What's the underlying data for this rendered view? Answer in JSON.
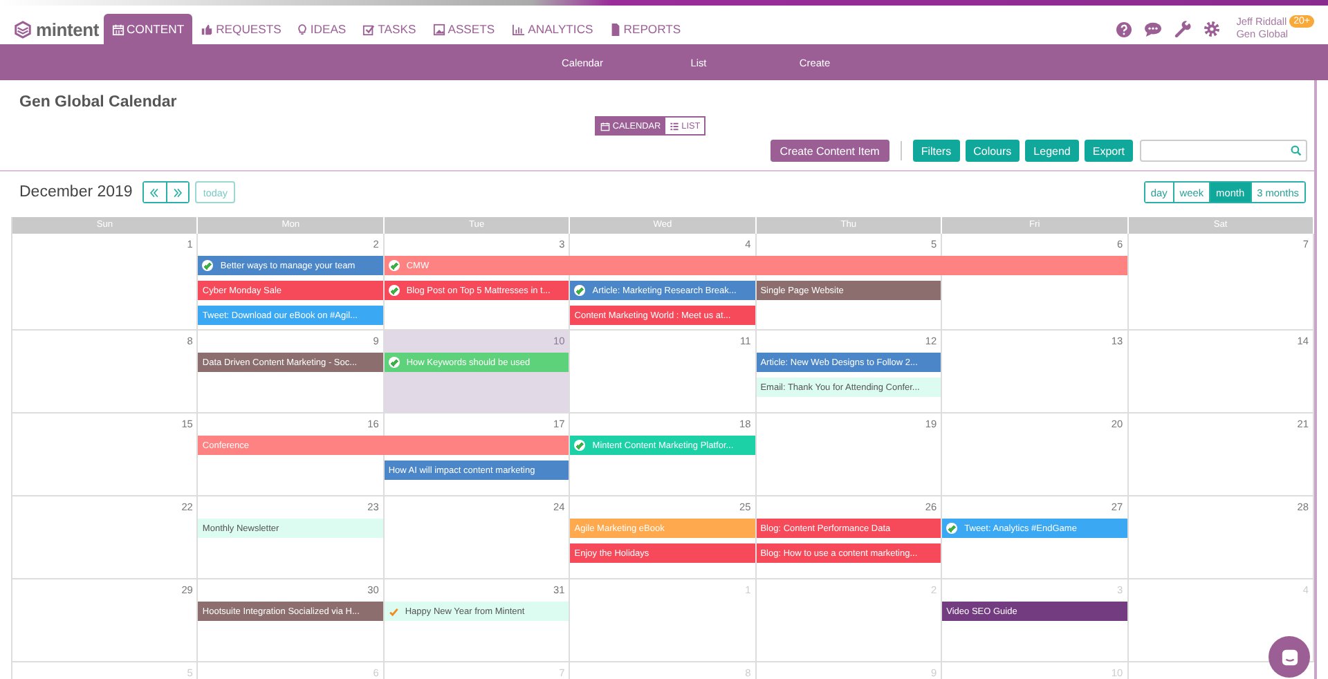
{
  "top_nav": {
    "logo": "mintent",
    "tabs": [
      {
        "label": "CONTENT",
        "selected": true
      },
      {
        "label": "REQUESTS",
        "selected": false
      },
      {
        "label": "IDEAS",
        "selected": false
      },
      {
        "label": "TASKS",
        "selected": false
      },
      {
        "label": "ASSETS",
        "selected": false
      },
      {
        "label": "ANALYTICS",
        "selected": false
      },
      {
        "label": "REPORTS",
        "selected": false
      }
    ],
    "user": {
      "name": "Jeff Riddall",
      "badge": "20+",
      "org": "Gen Global"
    }
  },
  "sub_nav": {
    "links": [
      "Calendar",
      "List",
      "Create"
    ]
  },
  "page": {
    "title": "Gen Global Calendar",
    "view_toggle": [
      {
        "label": "CALENDAR",
        "selected": true
      },
      {
        "label": "LIST",
        "selected": false
      }
    ],
    "actions": [
      {
        "label": "Create Content Item",
        "kind": "primary"
      },
      {
        "label": "Filters",
        "kind": "secondary"
      },
      {
        "label": "Colours",
        "kind": "secondary"
      },
      {
        "label": "Legend",
        "kind": "secondary"
      },
      {
        "label": "Export",
        "kind": "secondary"
      }
    ]
  },
  "calendar": {
    "month": "December 2019",
    "today_button": "today",
    "ranges": [
      {
        "label": "day",
        "selected": false
      },
      {
        "label": "week",
        "selected": false
      },
      {
        "label": "month",
        "selected": true
      },
      {
        "label": "3 months",
        "selected": false
      }
    ],
    "weekdays": [
      "Sun",
      "Mon",
      "Tue",
      "Wed",
      "Thu",
      "Fri",
      "Sat"
    ],
    "weeks": [
      {
        "days": [
          {
            "number": "1",
            "outside": false,
            "today": false
          },
          {
            "number": "2",
            "outside": false,
            "today": false
          },
          {
            "number": "3",
            "outside": false,
            "today": false
          },
          {
            "number": "4",
            "outside": false,
            "today": false
          },
          {
            "number": "5",
            "outside": false,
            "today": false
          },
          {
            "number": "6",
            "outside": false,
            "today": false
          },
          {
            "number": "7",
            "outside": false,
            "today": false
          }
        ],
        "lanes": [
          [
            {
              "kind": "empty"
            },
            {
              "kind": "event",
              "title": "Better ways to manage your team",
              "color": "#4a86c8",
              "checked": true,
              "check": {
                "color": "#3cb043"
              }
            },
            {
              "kind": "event",
              "title": "CMW",
              "color": "#ff8282",
              "checked": true,
              "check": {
                "color": "#3cb043"
              }
            },
            {
              "kind": "more"
            },
            {
              "kind": "more"
            },
            {
              "kind": "more"
            },
            {
              "kind": "empty"
            }
          ],
          [
            {
              "kind": "empty"
            },
            {
              "kind": "event",
              "title": "Cyber Monday Sale",
              "color": "#f64a5a",
              "checked": false
            },
            {
              "kind": "event",
              "title": "Blog Post on Top 5 Mattresses in t...",
              "color": "#f64a5a",
              "checked": true,
              "check": {
                "color": "#3cb043"
              }
            },
            {
              "kind": "event",
              "title": "Article: Marketing Research Break...",
              "color": "#4a86c8",
              "checked": true,
              "check": {
                "color": "#3cb043"
              }
            },
            {
              "kind": "event",
              "title": "Single Page Website",
              "color": "#8d6e6e",
              "checked": false
            },
            {
              "kind": "empty"
            },
            {
              "kind": "empty"
            }
          ],
          [
            {
              "kind": "empty"
            },
            {
              "kind": "event",
              "title": "Tweet: Download our eBook on #Agil...",
              "color": "#3aa8f2",
              "checked": false
            },
            {
              "kind": "empty"
            },
            {
              "kind": "event",
              "title": "Content Marketing World : Meet us at...",
              "color": "#f64a5a",
              "checked": false
            },
            {
              "kind": "empty"
            },
            {
              "kind": "empty"
            },
            {
              "kind": "empty"
            }
          ]
        ]
      },
      {
        "days": [
          {
            "number": "8",
            "outside": false,
            "today": false
          },
          {
            "number": "9",
            "outside": false,
            "today": false
          },
          {
            "number": "10",
            "outside": false,
            "today": true
          },
          {
            "number": "11",
            "outside": false,
            "today": false
          },
          {
            "number": "12",
            "outside": false,
            "today": false
          },
          {
            "number": "13",
            "outside": false,
            "today": false
          },
          {
            "number": "14",
            "outside": false,
            "today": false
          }
        ],
        "lanes": [
          [
            {
              "kind": "empty"
            },
            {
              "kind": "event",
              "title": "Data Driven Content Marketing - Soc...",
              "color": "#8d6e6e",
              "checked": false
            },
            {
              "kind": "event",
              "title": "How Keywords should be used",
              "color": "#5ed27a",
              "checked": true,
              "check": {
                "color": "#3cb043"
              }
            },
            {
              "kind": "empty"
            },
            {
              "kind": "event",
              "title": "Article: New Web Designs to Follow 2...",
              "color": "#4a86c8",
              "checked": false
            },
            {
              "kind": "empty"
            },
            {
              "kind": "empty"
            }
          ],
          [
            {
              "kind": "empty"
            },
            {
              "kind": "empty"
            },
            {
              "kind": "empty"
            },
            {
              "kind": "empty"
            },
            {
              "kind": "event",
              "title": "Email: Thank You for Attending Confer...",
              "color": "#dcfbf1",
              "checked": false
            },
            {
              "kind": "empty"
            },
            {
              "kind": "empty"
            }
          ]
        ]
      },
      {
        "days": [
          {
            "number": "15",
            "outside": false,
            "today": false
          },
          {
            "number": "16",
            "outside": false,
            "today": false
          },
          {
            "number": "17",
            "outside": false,
            "today": false
          },
          {
            "number": "18",
            "outside": false,
            "today": false
          },
          {
            "number": "19",
            "outside": false,
            "today": false
          },
          {
            "number": "20",
            "outside": false,
            "today": false
          },
          {
            "number": "21",
            "outside": false,
            "today": false
          }
        ],
        "lanes": [
          [
            {
              "kind": "empty"
            },
            {
              "kind": "event",
              "title": "Conference",
              "color": "#ff8282",
              "checked": false
            },
            {
              "kind": "more"
            },
            {
              "kind": "event",
              "title": "Mintent Content Marketing Platfor...",
              "color": "#1dd1a7",
              "checked": true,
              "check": {
                "color": "#3cb043"
              }
            },
            {
              "kind": "empty"
            },
            {
              "kind": "empty"
            },
            {
              "kind": "empty"
            }
          ],
          [
            {
              "kind": "empty"
            },
            {
              "kind": "empty"
            },
            {
              "kind": "event",
              "title": "How AI will impact content marketing",
              "color": "#4a86c8",
              "checked": false
            },
            {
              "kind": "empty"
            },
            {
              "kind": "empty"
            },
            {
              "kind": "empty"
            },
            {
              "kind": "empty"
            }
          ]
        ]
      },
      {
        "days": [
          {
            "number": "22",
            "outside": false,
            "today": false
          },
          {
            "number": "23",
            "outside": false,
            "today": false
          },
          {
            "number": "24",
            "outside": false,
            "today": false
          },
          {
            "number": "25",
            "outside": false,
            "today": false
          },
          {
            "number": "26",
            "outside": false,
            "today": false
          },
          {
            "number": "27",
            "outside": false,
            "today": false
          },
          {
            "number": "28",
            "outside": false,
            "today": false
          }
        ],
        "lanes": [
          [
            {
              "kind": "empty"
            },
            {
              "kind": "event",
              "title": "Monthly Newsletter",
              "color": "#dcfbf1",
              "checked": false
            },
            {
              "kind": "empty"
            },
            {
              "kind": "event",
              "title": "Agile Marketing eBook",
              "color": "#ffa94f",
              "checked": false
            },
            {
              "kind": "event",
              "title": "Blog: Content Performance Data",
              "color": "#f64a5a",
              "checked": false
            },
            {
              "kind": "event",
              "title": "Tweet: Analytics #EndGame",
              "color": "#3aa8f2",
              "checked": true,
              "check": {
                "color": "#3cb043"
              }
            },
            {
              "kind": "empty"
            }
          ],
          [
            {
              "kind": "empty"
            },
            {
              "kind": "empty"
            },
            {
              "kind": "empty"
            },
            {
              "kind": "event",
              "title": "Enjoy the Holidays",
              "color": "#f64a5a",
              "checked": false
            },
            {
              "kind": "event",
              "title": "Blog: How to use a content marketing...",
              "color": "#f64a5a",
              "checked": false
            },
            {
              "kind": "empty"
            },
            {
              "kind": "empty"
            }
          ]
        ]
      },
      {
        "days": [
          {
            "number": "29",
            "outside": false,
            "today": false
          },
          {
            "number": "30",
            "outside": false,
            "today": false
          },
          {
            "number": "31",
            "outside": false,
            "today": false
          },
          {
            "number": "1",
            "outside": true,
            "today": false
          },
          {
            "number": "2",
            "outside": true,
            "today": false
          },
          {
            "number": "3",
            "outside": true,
            "today": false
          },
          {
            "number": "4",
            "outside": true,
            "today": false
          }
        ],
        "lanes": [
          [
            {
              "kind": "empty"
            },
            {
              "kind": "event",
              "title": "Hootsuite Integration Socialized via H...",
              "color": "#8d6e6e",
              "checked": false
            },
            {
              "kind": "event",
              "title": "Happy New Year from Mintent",
              "color": "#dcfbf1",
              "checked": true,
              "check": {
                "color": "#f28b1e"
              }
            },
            {
              "kind": "empty"
            },
            {
              "kind": "empty"
            },
            {
              "kind": "event",
              "title": "Video SEO Guide",
              "color": "#733c80",
              "checked": false
            },
            {
              "kind": "empty"
            }
          ]
        ]
      },
      {
        "days": [
          {
            "number": "5",
            "outside": true,
            "today": false
          },
          {
            "number": "6",
            "outside": true,
            "today": false
          },
          {
            "number": "7",
            "outside": true,
            "today": false
          },
          {
            "number": "8",
            "outside": true,
            "today": false
          },
          {
            "number": "9",
            "outside": true,
            "today": false
          },
          {
            "number": "10",
            "outside": true,
            "today": false
          }
        ]
      }
    ]
  }
}
